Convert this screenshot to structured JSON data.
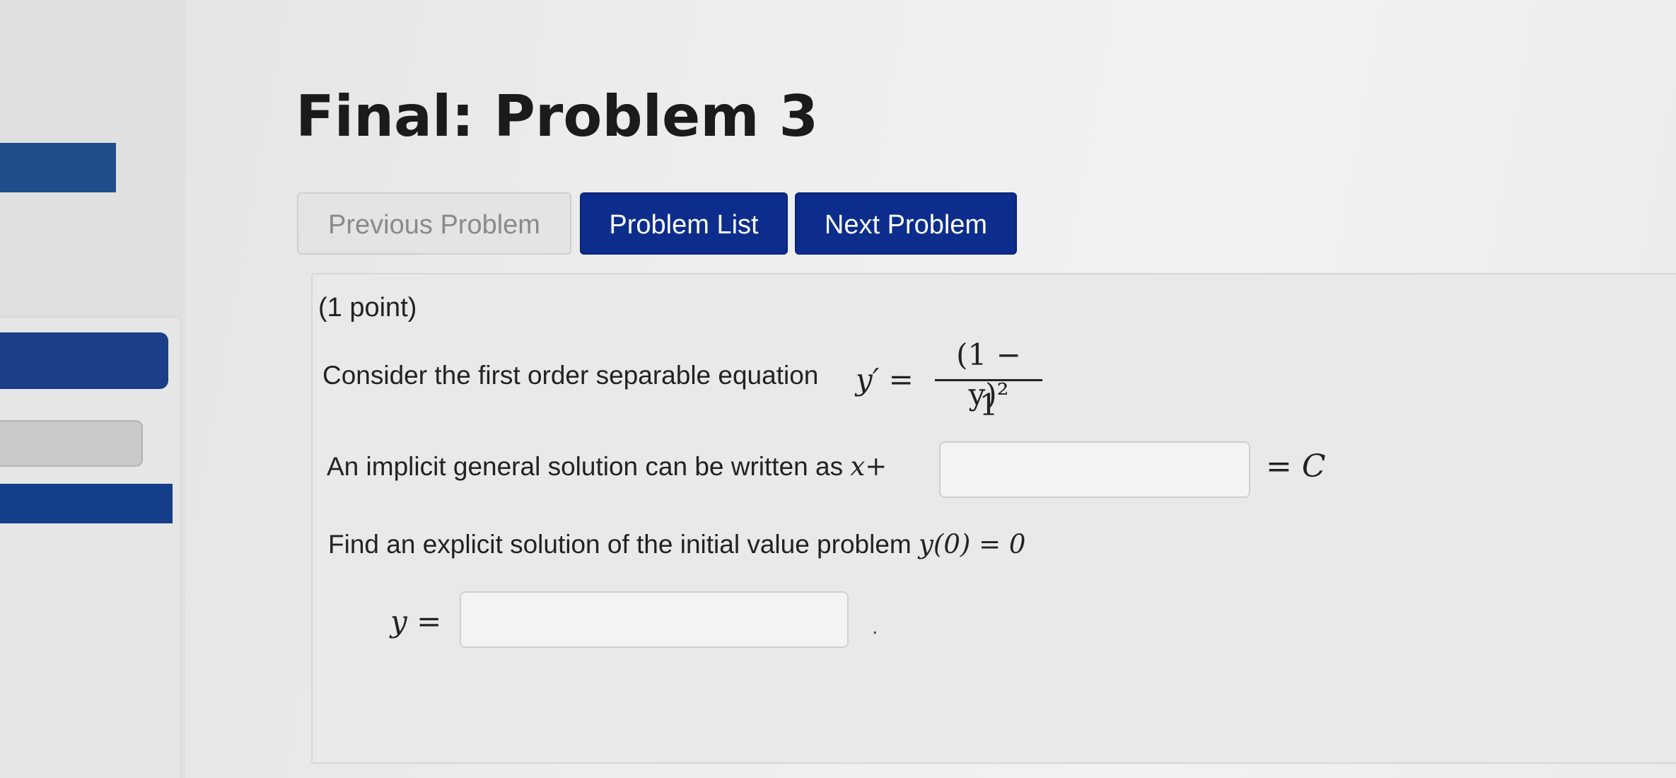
{
  "page": {
    "title": "Final: Problem 3"
  },
  "nav": {
    "previous_label": "Previous Problem",
    "list_label": "Problem List",
    "next_label": "Next Problem"
  },
  "problem": {
    "points": "(1 point)",
    "statement_text": "Consider the first order separable equation",
    "equation_lhs": "y′ =",
    "equation_numerator": "(1 − y)²",
    "equation_denominator": "1",
    "implicit_text": "An implicit general solution can be written as",
    "implicit_prefix": "x+",
    "implicit_suffix": "= C",
    "implicit_answer_value": "",
    "explicit_text": "Find an explicit solution of the initial value problem",
    "initial_condition": "y(0) = 0",
    "explicit_label": "y =",
    "explicit_answer_value": "",
    "trailing_mark": "."
  },
  "colors": {
    "button_primary": "#0d2d8c",
    "button_disabled": "#e4e4e4",
    "sidebar_accent": "#1a3f88"
  }
}
